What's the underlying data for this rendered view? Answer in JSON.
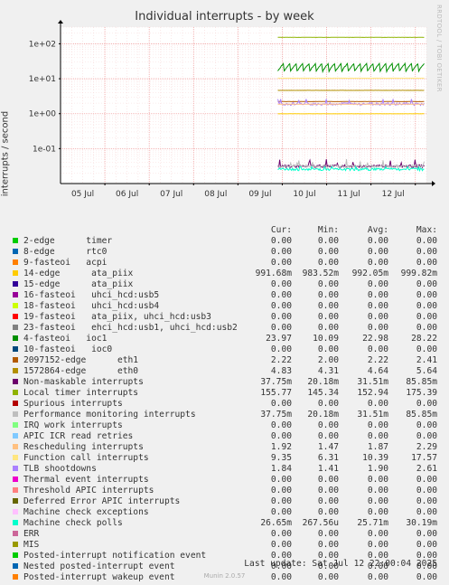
{
  "title": "Individual interrupts - by week",
  "watermark": "RRDTOOL / TOBI OETIKER",
  "ylabel": "interrupts / second",
  "legend_headers": {
    "cur": "Cur:",
    "min": "Min:",
    "avg": "Avg:",
    "max": "Max:"
  },
  "legend": [
    {
      "name": "2-edge      timer",
      "color": "#00cc00",
      "cur": "0.00",
      "min": "0.00",
      "avg": "0.00",
      "max": "0.00"
    },
    {
      "name": "8-edge      rtc0",
      "color": "#0066b3",
      "cur": "0.00",
      "min": "0.00",
      "avg": "0.00",
      "max": "0.00"
    },
    {
      "name": "9-fasteoi   acpi",
      "color": "#ff8000",
      "cur": "0.00",
      "min": "0.00",
      "avg": "0.00",
      "max": "0.00"
    },
    {
      "name": "14-edge      ata_piix",
      "color": "#ffcc00",
      "cur": "991.68m",
      "min": "983.52m",
      "avg": "992.05m",
      "max": "999.82m"
    },
    {
      "name": "15-edge      ata_piix",
      "color": "#330099",
      "cur": "0.00",
      "min": "0.00",
      "avg": "0.00",
      "max": "0.00"
    },
    {
      "name": "16-fasteoi   uhci_hcd:usb5",
      "color": "#990099",
      "cur": "0.00",
      "min": "0.00",
      "avg": "0.00",
      "max": "0.00"
    },
    {
      "name": "18-fasteoi   uhci_hcd:usb4",
      "color": "#ccff00",
      "cur": "0.00",
      "min": "0.00",
      "avg": "0.00",
      "max": "0.00"
    },
    {
      "name": "19-fasteoi   ata_piix, uhci_hcd:usb3",
      "color": "#ff0000",
      "cur": "0.00",
      "min": "0.00",
      "avg": "0.00",
      "max": "0.00"
    },
    {
      "name": "23-fasteoi   ehci_hcd:usb1, uhci_hcd:usb2",
      "color": "#808080",
      "cur": "0.00",
      "min": "0.00",
      "avg": "0.00",
      "max": "0.00"
    },
    {
      "name": "4-fasteoi   ioc1",
      "color": "#008f00",
      "cur": "23.97",
      "min": "10.09",
      "avg": "22.98",
      "max": "28.22"
    },
    {
      "name": "10-fasteoi   ioc0",
      "color": "#00487d",
      "cur": "0.00",
      "min": "0.00",
      "avg": "0.00",
      "max": "0.00"
    },
    {
      "name": "2097152-edge      eth1",
      "color": "#b35a00",
      "cur": "2.22",
      "min": "2.00",
      "avg": "2.22",
      "max": "2.41"
    },
    {
      "name": "1572864-edge      eth0",
      "color": "#b38f00",
      "cur": "4.83",
      "min": "4.31",
      "avg": "4.64",
      "max": "5.64"
    },
    {
      "name": "Non-maskable interrupts",
      "color": "#6b006b",
      "cur": "37.75m",
      "min": "20.18m",
      "avg": "31.51m",
      "max": "85.85m"
    },
    {
      "name": "Local timer interrupts",
      "color": "#8fb300",
      "cur": "155.77",
      "min": "145.34",
      "avg": "152.94",
      "max": "175.39"
    },
    {
      "name": "Spurious interrupts",
      "color": "#b30000",
      "cur": "0.00",
      "min": "0.00",
      "avg": "0.00",
      "max": "0.00"
    },
    {
      "name": "Performance monitoring interrupts",
      "color": "#bebebe",
      "cur": "37.75m",
      "min": "20.18m",
      "avg": "31.51m",
      "max": "85.85m"
    },
    {
      "name": "IRQ work interrupts",
      "color": "#80ff80",
      "cur": "0.00",
      "min": "0.00",
      "avg": "0.00",
      "max": "0.00"
    },
    {
      "name": "APIC ICR read retries",
      "color": "#80c9ff",
      "cur": "0.00",
      "min": "0.00",
      "avg": "0.00",
      "max": "0.00"
    },
    {
      "name": "Rescheduling interrupts",
      "color": "#ffc080",
      "cur": "1.92",
      "min": "1.47",
      "avg": "1.87",
      "max": "2.29"
    },
    {
      "name": "Function call interrupts",
      "color": "#ffe680",
      "cur": "9.35",
      "min": "6.31",
      "avg": "10.39",
      "max": "17.57"
    },
    {
      "name": "TLB shootdowns",
      "color": "#aa80ff",
      "cur": "1.84",
      "min": "1.41",
      "avg": "1.90",
      "max": "2.61"
    },
    {
      "name": "Thermal event interrupts",
      "color": "#ee00cc",
      "cur": "0.00",
      "min": "0.00",
      "avg": "0.00",
      "max": "0.00"
    },
    {
      "name": "Threshold APIC interrupts",
      "color": "#ff8080",
      "cur": "0.00",
      "min": "0.00",
      "avg": "0.00",
      "max": "0.00"
    },
    {
      "name": "Deferred Error APIC interrupts",
      "color": "#666600",
      "cur": "0.00",
      "min": "0.00",
      "avg": "0.00",
      "max": "0.00"
    },
    {
      "name": "Machine check exceptions",
      "color": "#ffbfff",
      "cur": "0.00",
      "min": "0.00",
      "avg": "0.00",
      "max": "0.00"
    },
    {
      "name": "Machine check polls",
      "color": "#00ffcc",
      "cur": "26.65m",
      "min": "267.56u",
      "avg": "25.71m",
      "max": "30.19m"
    },
    {
      "name": "ERR",
      "color": "#cc6699",
      "cur": "0.00",
      "min": "0.00",
      "avg": "0.00",
      "max": "0.00"
    },
    {
      "name": "MIS",
      "color": "#999900",
      "cur": "0.00",
      "min": "0.00",
      "avg": "0.00",
      "max": "0.00"
    },
    {
      "name": "Posted-interrupt notification event",
      "color": "#00cc00",
      "cur": "0.00",
      "min": "0.00",
      "avg": "0.00",
      "max": "0.00"
    },
    {
      "name": "Nested posted-interrupt event",
      "color": "#0066b3",
      "cur": "0.00",
      "min": "0.00",
      "avg": "0.00",
      "max": "0.00"
    },
    {
      "name": "Posted-interrupt wakeup event",
      "color": "#ff8000",
      "cur": "0.00",
      "min": "0.00",
      "avg": "0.00",
      "max": "0.00"
    }
  ],
  "footer": {
    "last_update": "Last update: Sat Jul 12 22:00:04 2025",
    "munin": "Munin 2.0.57"
  },
  "chart_data": {
    "type": "line",
    "title": "Individual interrupts - by week",
    "ylabel": "interrupts / second",
    "xlabel": "",
    "yscale": "log",
    "ylim": [
      0.01,
      300
    ],
    "y_ticks": [
      {
        "label": "1e+02",
        "value": 100
      },
      {
        "label": "1e+01",
        "value": 10
      },
      {
        "label": "1e+00",
        "value": 1
      },
      {
        "label": "1e-01",
        "value": 0.1
      }
    ],
    "x_ticks": [
      "05 Jul",
      "06 Jul",
      "07 Jul",
      "08 Jul",
      "09 Jul",
      "10 Jul",
      "11 Jul",
      "12 Jul"
    ],
    "x_range_days": [
      0,
      8.25
    ],
    "data_start_day": 4.9,
    "grid": true,
    "series": [
      {
        "name": "Local timer interrupts",
        "color": "#8fb300",
        "avg": 152.94,
        "min": 145.34,
        "max": 175.39,
        "pattern": "flat"
      },
      {
        "name": "4-fasteoi   ioc1",
        "color": "#008f00",
        "avg": 22.98,
        "min": 10.09,
        "max": 28.22,
        "pattern": "sawtooth"
      },
      {
        "name": "Function call interrupts",
        "color": "#ffe680",
        "avg": 10.39,
        "min": 6.31,
        "max": 17.57,
        "pattern": "flat"
      },
      {
        "name": "1572864-edge      eth0",
        "color": "#b38f00",
        "avg": 4.64,
        "min": 4.31,
        "max": 5.64,
        "pattern": "flat"
      },
      {
        "name": "2097152-edge      eth1",
        "color": "#b35a00",
        "avg": 2.22,
        "min": 2.0,
        "max": 2.41,
        "pattern": "flat"
      },
      {
        "name": "TLB shootdowns",
        "color": "#aa80ff",
        "avg": 1.9,
        "min": 1.41,
        "max": 2.61,
        "pattern": "noisy"
      },
      {
        "name": "Rescheduling interrupts",
        "color": "#ffc080",
        "avg": 1.87,
        "min": 1.47,
        "max": 2.29,
        "pattern": "flat"
      },
      {
        "name": "14-edge      ata_piix",
        "color": "#ffcc00",
        "avg": 0.992,
        "min": 0.9835,
        "max": 0.9998,
        "pattern": "flat"
      },
      {
        "name": "Non-maskable interrupts",
        "color": "#6b006b",
        "avg": 0.0315,
        "min": 0.0202,
        "max": 0.0859,
        "pattern": "noisy"
      },
      {
        "name": "Performance monitoring interrupts",
        "color": "#bebebe",
        "avg": 0.0315,
        "min": 0.0202,
        "max": 0.0859,
        "pattern": "noisy"
      },
      {
        "name": "Machine check polls",
        "color": "#00ffcc",
        "avg": 0.0257,
        "min": 0.000268,
        "max": 0.0302,
        "pattern": "noisy"
      }
    ]
  }
}
